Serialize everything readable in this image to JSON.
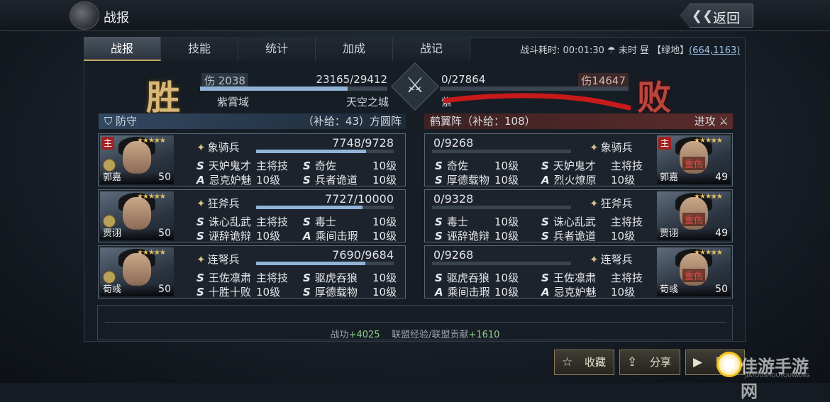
{
  "header": {
    "title": "战报",
    "back_label": "返回"
  },
  "tabs": [
    {
      "label": "战报"
    },
    {
      "label": "技能"
    },
    {
      "label": "统计"
    },
    {
      "label": "加成"
    },
    {
      "label": "战记"
    }
  ],
  "battle_info": {
    "duration": "战斗耗时: 00:01:30",
    "weather": "未时 昼",
    "terrain": "【绿地】",
    "coords": "(664,1163)"
  },
  "result": {
    "win": "胜",
    "lose": "败"
  },
  "left_side": {
    "damage": "伤 2038",
    "troops": "23165/29412",
    "troops_fraction": 0.7876,
    "name": "紫霄域",
    "city": "天空之城",
    "formation_label": "防守",
    "formation_info": "（补给：43）方圆阵"
  },
  "right_side": {
    "damage": "伤14647",
    "troops": "0/27864",
    "troops_fraction": 0,
    "name_partial": "紫",
    "formation_label": "进攻",
    "formation_info": "鹤翼阵（补给：108）"
  },
  "left_cards": [
    {
      "name": "郭嘉",
      "level": "50",
      "main": "主",
      "stars": "★★★★★",
      "unit": "象骑兵",
      "troops": "7748/9728",
      "fraction": 0.7965,
      "skills": [
        {
          "g": "S",
          "n": "天妒鬼才",
          "l": "主将技"
        },
        {
          "g": "S",
          "n": "奇佐",
          "l": "10级"
        },
        {
          "g": "A",
          "n": "忌克妒魅",
          "l": "10级"
        },
        {
          "g": "S",
          "n": "兵者诡道",
          "l": "10级"
        }
      ]
    },
    {
      "name": "贾诩",
      "level": "50",
      "main": "",
      "stars": "★★★★★",
      "unit": "狂斧兵",
      "troops": "7727/10000",
      "fraction": 0.7727,
      "skills": [
        {
          "g": "S",
          "n": "诛心乱武",
          "l": "主将技"
        },
        {
          "g": "S",
          "n": "毒士",
          "l": "10级"
        },
        {
          "g": "S",
          "n": "诬辞诡辩",
          "l": "10级"
        },
        {
          "g": "A",
          "n": "乘间击瑕",
          "l": "10级"
        }
      ]
    },
    {
      "name": "荀彧",
      "level": "50",
      "main": "",
      "stars": "★★★★★",
      "unit": "连弩兵",
      "troops": "7690/9684",
      "fraction": 0.7941,
      "skills": [
        {
          "g": "S",
          "n": "王佐凛肃",
          "l": "主将技"
        },
        {
          "g": "S",
          "n": "驱虎吞狼",
          "l": "10级"
        },
        {
          "g": "S",
          "n": "十胜十败",
          "l": "10级"
        },
        {
          "g": "S",
          "n": "厚德载物",
          "l": "10级"
        }
      ]
    }
  ],
  "right_cards": [
    {
      "name": "郭嘉",
      "level": "49",
      "main": "主",
      "stars": "★★★★★",
      "status": "重伤",
      "unit": "象骑兵",
      "troops": "0/9268",
      "fraction": 0,
      "skills": [
        {
          "g": "S",
          "n": "奇佐",
          "l": "10级"
        },
        {
          "g": "S",
          "n": "天妒鬼才",
          "l": "主将技"
        },
        {
          "g": "S",
          "n": "厚德载物",
          "l": "10级"
        },
        {
          "g": "A",
          "n": "烈火燎原",
          "l": "10级"
        }
      ]
    },
    {
      "name": "贾诩",
      "level": "49",
      "main": "",
      "stars": "★★★★★",
      "status": "重伤",
      "unit": "狂斧兵",
      "troops": "0/9328",
      "fraction": 0,
      "skills": [
        {
          "g": "S",
          "n": "毒士",
          "l": "10级"
        },
        {
          "g": "S",
          "n": "诛心乱武",
          "l": "主将技"
        },
        {
          "g": "S",
          "n": "诬辞诡辩",
          "l": "10级"
        },
        {
          "g": "S",
          "n": "兵者诡道",
          "l": "10级"
        }
      ]
    },
    {
      "name": "荀彧",
      "level": "50",
      "main": "",
      "stars": "★★★★★",
      "status": "重伤",
      "unit": "连弩兵",
      "troops": "0/9268",
      "fraction": 0,
      "skills": [
        {
          "g": "S",
          "n": "驱虎吞狼",
          "l": "10级"
        },
        {
          "g": "S",
          "n": "王佐凛肃",
          "l": "主将技"
        },
        {
          "g": "A",
          "n": "乘间击瑕",
          "l": "10级"
        },
        {
          "g": "A",
          "n": "忌克妒魅",
          "l": "10级"
        }
      ]
    }
  ],
  "rewards": {
    "merit_label": "战功",
    "merit_value": "+4025",
    "alliance_label": "联盟经验/联盟贡献",
    "alliance_value": "+1610"
  },
  "buttons": {
    "favorite": "收藏",
    "share": "分享",
    "replay": "回放"
  },
  "watermark": {
    "text": "佳游手游网",
    "sub": "JIAYOUSHOUYOUWANG"
  },
  "colors": {
    "gold": "#c8a860",
    "win_bar": "#8fb4d8",
    "lose_red": "#b9463e",
    "green": "#8fd18c"
  }
}
